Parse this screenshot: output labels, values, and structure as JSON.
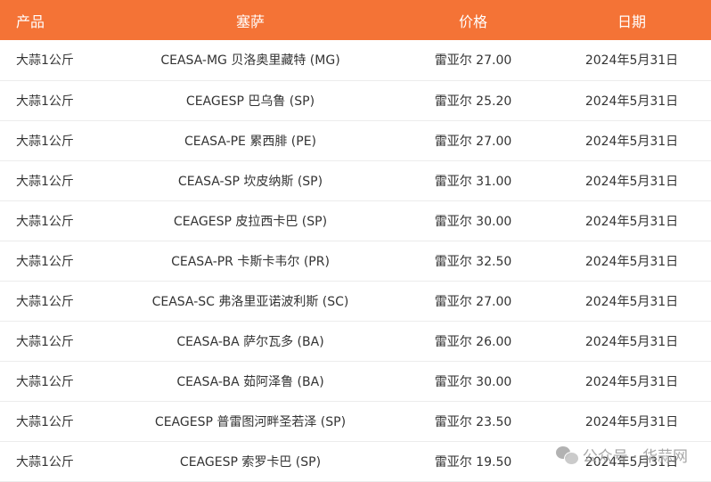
{
  "table": {
    "accent_color": "#f47336",
    "headers": [
      "产品",
      "塞萨",
      "价格",
      "日期"
    ],
    "rows": [
      [
        "大蒜1公斤",
        "CEASA-MG 贝洛奥里藏特 (MG)",
        "雷亚尔 27.00",
        "2024年5月31日"
      ],
      [
        "大蒜1公斤",
        "CEAGESP 巴乌鲁 (SP)",
        "雷亚尔 25.20",
        "2024年5月31日"
      ],
      [
        "大蒜1公斤",
        "CEASA-PE 累西腓 (PE)",
        "雷亚尔 27.00",
        "2024年5月31日"
      ],
      [
        "大蒜1公斤",
        "CEASA-SP 坎皮纳斯 (SP)",
        "雷亚尔 31.00",
        "2024年5月31日"
      ],
      [
        "大蒜1公斤",
        "CEAGESP 皮拉西卡巴 (SP)",
        "雷亚尔 30.00",
        "2024年5月31日"
      ],
      [
        "大蒜1公斤",
        "CEASA-PR 卡斯卡韦尔 (PR)",
        "雷亚尔 32.50",
        "2024年5月31日"
      ],
      [
        "大蒜1公斤",
        "CEASA-SC 弗洛里亚诺波利斯 (SC)",
        "雷亚尔 27.00",
        "2024年5月31日"
      ],
      [
        "大蒜1公斤",
        "CEASA-BA 萨尔瓦多 (BA)",
        "雷亚尔 26.00",
        "2024年5月31日"
      ],
      [
        "大蒜1公斤",
        "CEASA-BA 茹阿泽鲁 (BA)",
        "雷亚尔 30.00",
        "2024年5月31日"
      ],
      [
        "大蒜1公斤",
        "CEAGESP 普雷图河畔圣若泽 (SP)",
        "雷亚尔 23.50",
        "2024年5月31日"
      ],
      [
        "大蒜1公斤",
        "CEAGESP 索罗卡巴 (SP)",
        "雷亚尔 19.50",
        "2024年5月31日"
      ]
    ]
  },
  "watermark": {
    "text": "公众号 · 华蒜网",
    "icon": "wechat-icon"
  }
}
